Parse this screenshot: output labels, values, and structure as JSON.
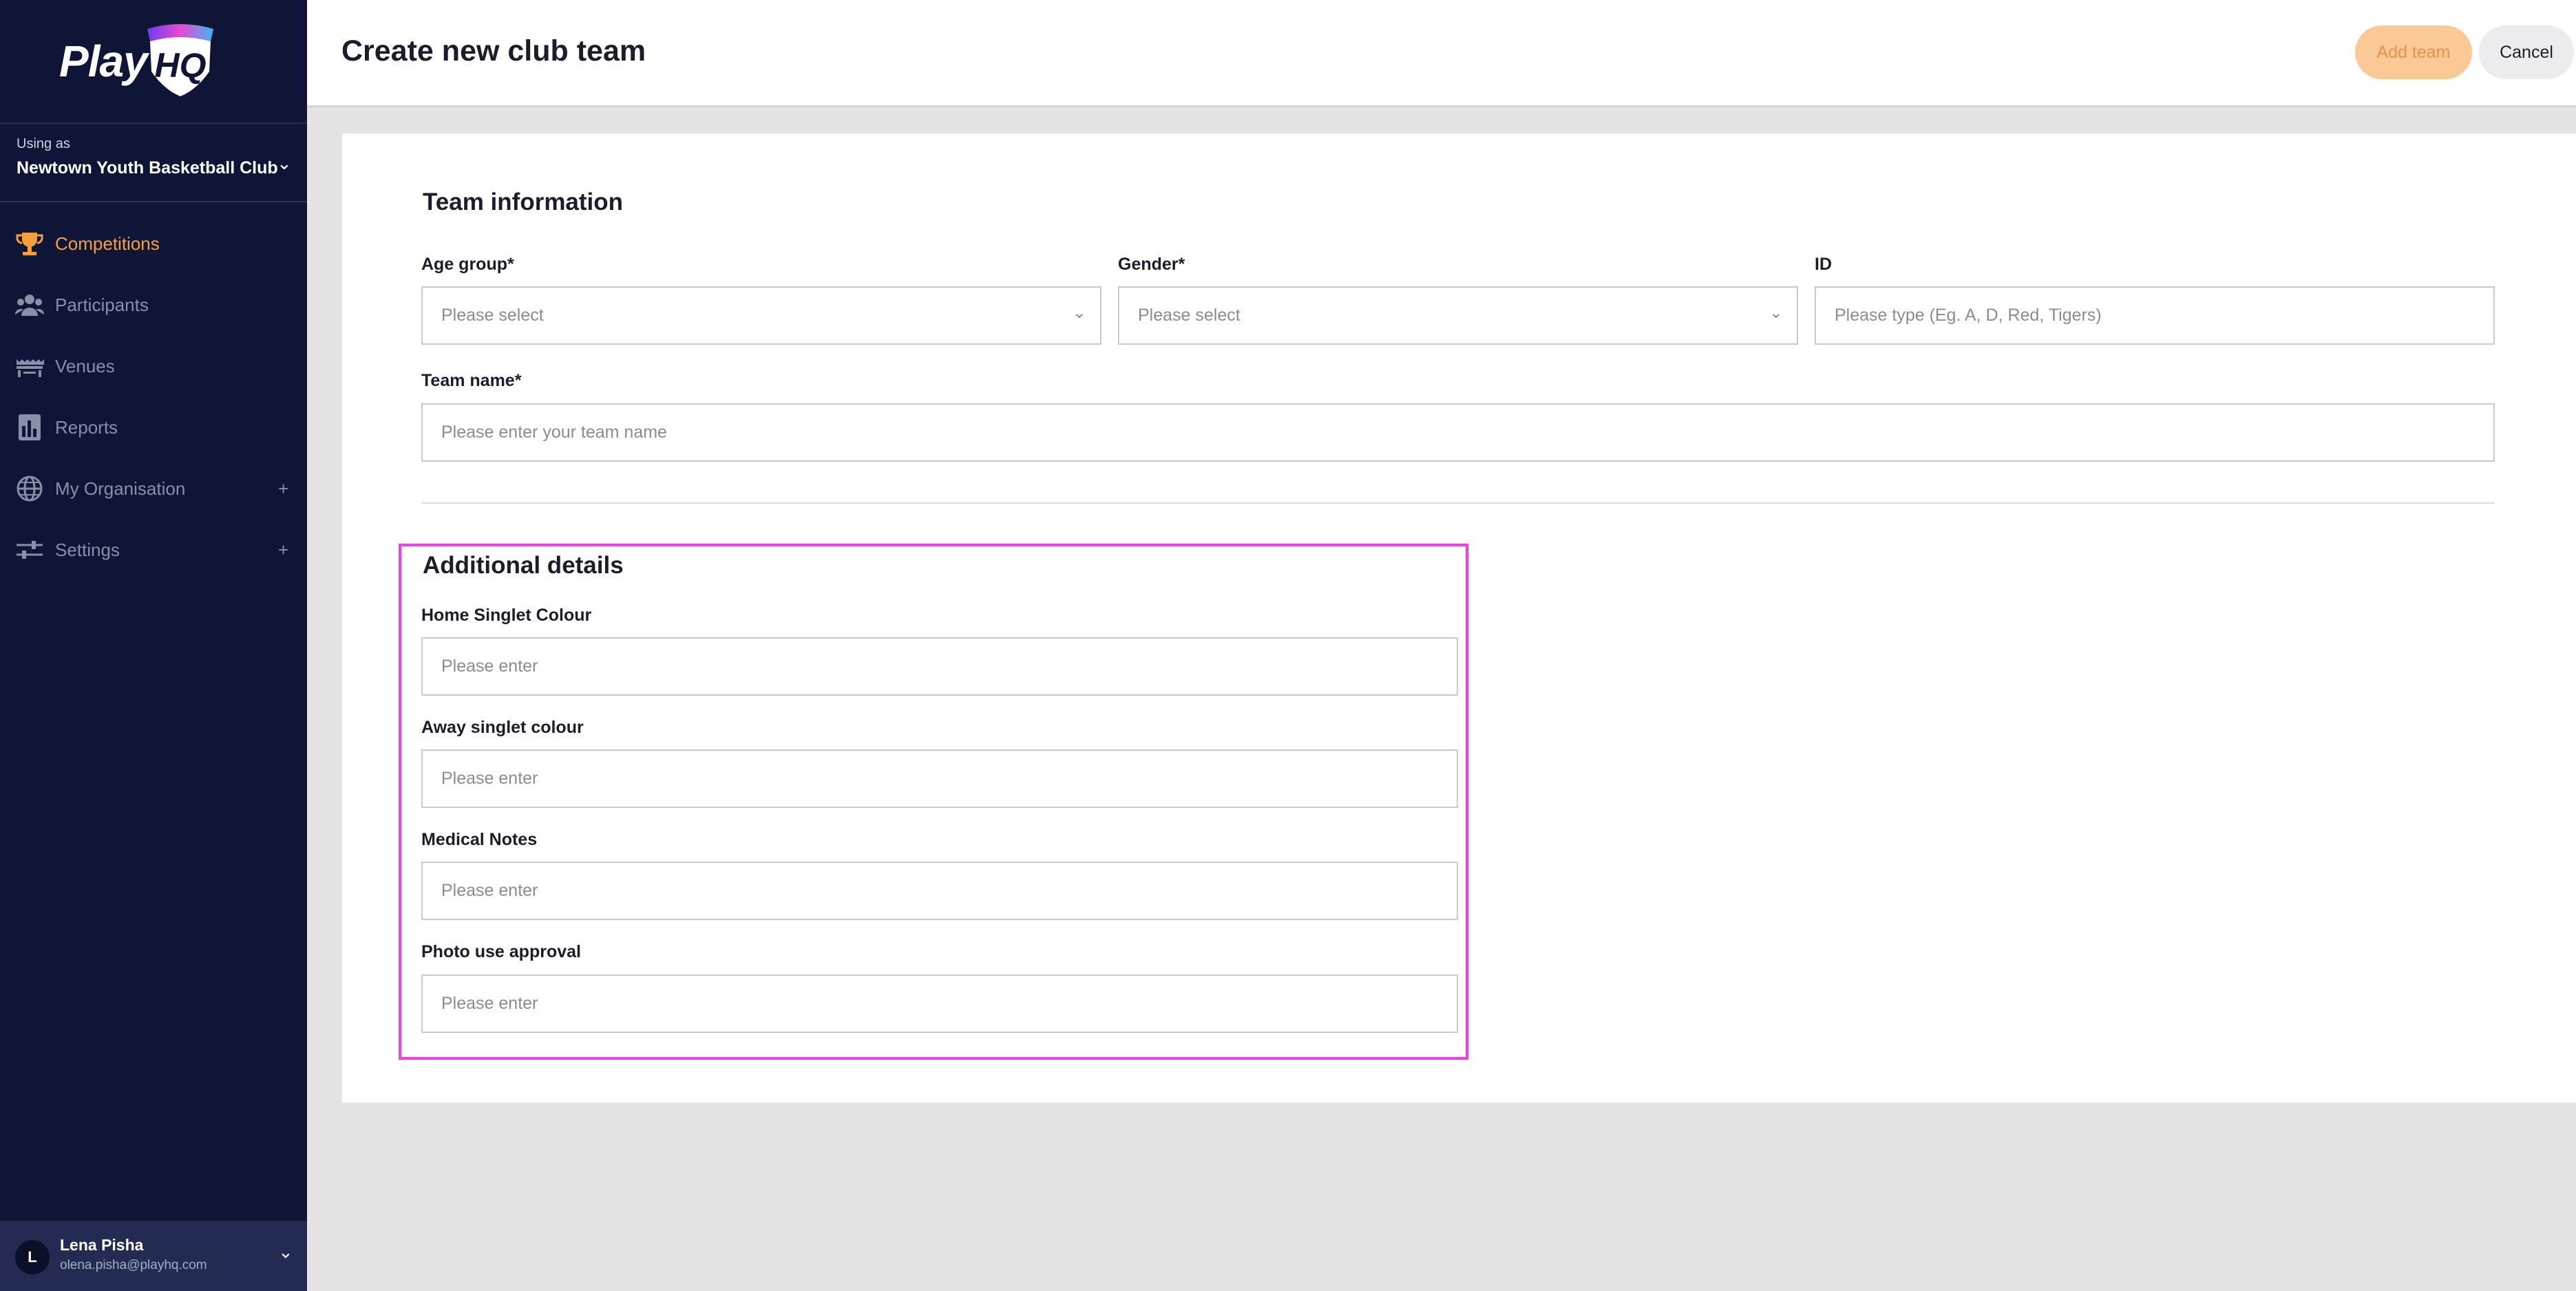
{
  "brand": {
    "logo_text": "Play",
    "logo_mark": "HQ"
  },
  "club": {
    "using_as_label": "Using as",
    "name": "Newtown Youth Basketball Club"
  },
  "sidebar": {
    "items": [
      {
        "label": "Competitions",
        "icon": "trophy-icon",
        "active": true
      },
      {
        "label": "Participants",
        "icon": "people-icon",
        "active": false
      },
      {
        "label": "Venues",
        "icon": "stadium-icon",
        "active": false
      },
      {
        "label": "Reports",
        "icon": "reports-icon",
        "active": false
      },
      {
        "label": "My Organisation",
        "icon": "globe-icon",
        "active": false,
        "expandable": "+"
      },
      {
        "label": "Settings",
        "icon": "sliders-icon",
        "active": false,
        "expandable": "+"
      }
    ]
  },
  "user": {
    "initial": "L",
    "name": "Lena Pisha",
    "email": "olena.pisha@playhq.com"
  },
  "header": {
    "title": "Create new club team",
    "add_label": "Add team",
    "cancel_label": "Cancel"
  },
  "team_info": {
    "title": "Team information",
    "age_group": {
      "label": "Age group*",
      "placeholder": "Please select"
    },
    "gender": {
      "label": "Gender*",
      "placeholder": "Please select"
    },
    "id": {
      "label": "ID",
      "placeholder": "Please type (Eg. A, D, Red, Tigers)"
    },
    "team_name": {
      "label": "Team name*",
      "placeholder": "Please enter your team name"
    }
  },
  "additional": {
    "title": "Additional details",
    "home_colour": {
      "label": "Home Singlet Colour",
      "placeholder": "Please enter"
    },
    "away_colour": {
      "label": "Away singlet colour",
      "placeholder": "Please enter"
    },
    "medical": {
      "label": "Medical Notes",
      "placeholder": "Please enter"
    },
    "photo": {
      "label": "Photo use approval",
      "placeholder": "Please enter"
    }
  },
  "colors": {
    "sidebar": "#0f1537",
    "accent": "#f5a03a",
    "highlight": "#f03ee8"
  }
}
